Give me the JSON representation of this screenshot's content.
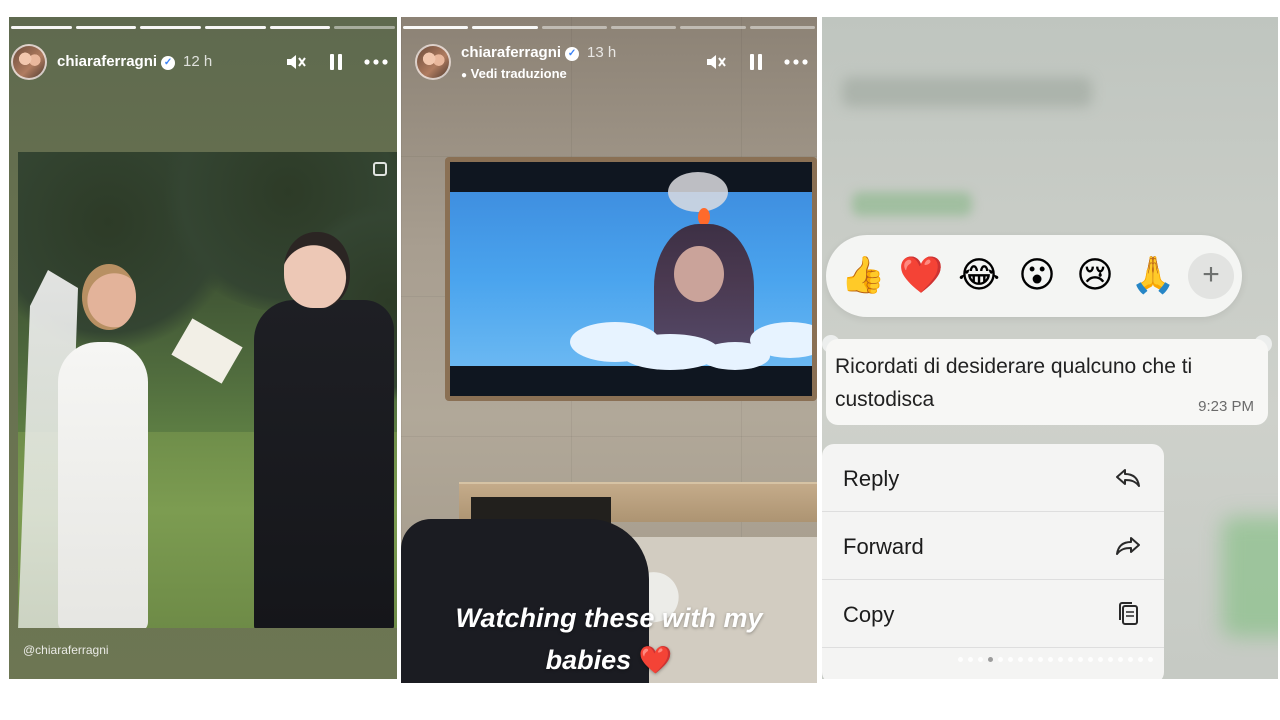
{
  "story1": {
    "username": "chiaraferragni",
    "time": "12 h",
    "credit": "@chiaraferragni",
    "progress_segments": 6,
    "progress_done": 5
  },
  "story2": {
    "username": "chiaraferragni",
    "time": "13 h",
    "translate_label": "Vedi traduzione",
    "caption_line1": "Watching these with my",
    "caption_line2": "babies",
    "caption_emoji": "❤️",
    "progress_segments": 6,
    "progress_done": 2
  },
  "chat": {
    "reactions": [
      "👍",
      "❤️",
      "😂",
      "😮",
      "😢",
      "🙏"
    ],
    "more_reactions": "+",
    "message_text": "Ricordati di desiderare qualcuno che ti custodisca",
    "message_time": "9:23 PM",
    "menu": [
      {
        "label": "Reply",
        "icon": "reply-icon"
      },
      {
        "label": "Forward",
        "icon": "forward-icon"
      },
      {
        "label": "Copy",
        "icon": "copy-icon"
      }
    ],
    "page_dots": 20,
    "page_dot_active": 3
  },
  "colors": {
    "story1_bg": "#66704f",
    "heart": "#e03131",
    "verified": "#3b82f6",
    "menu_bg": "#f4f4f3"
  }
}
